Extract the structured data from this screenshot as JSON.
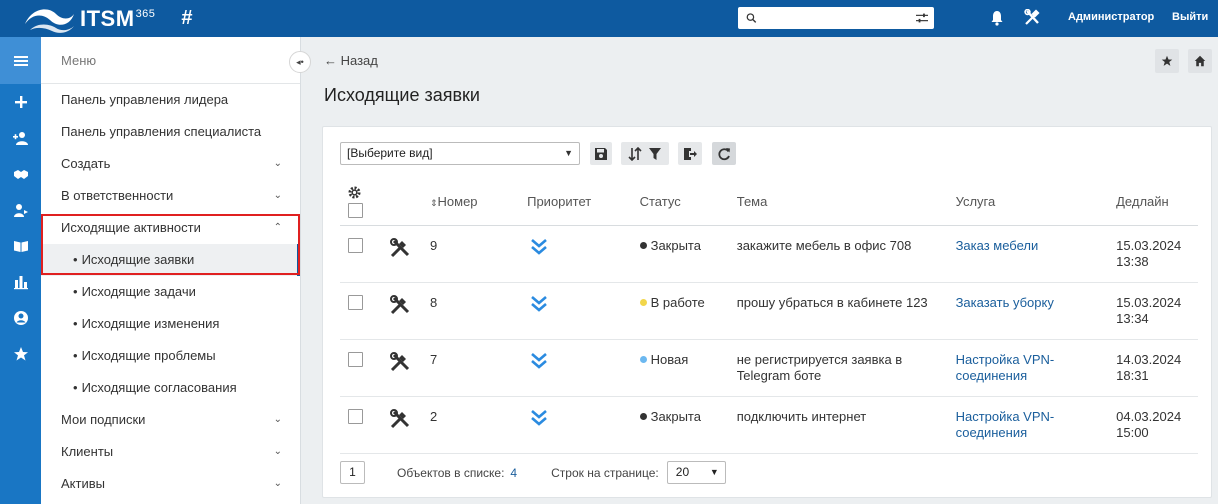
{
  "app": {
    "name": "ITSM",
    "version": "365"
  },
  "topbar": {
    "user": "Администратор",
    "logout": "Выйти",
    "search_value": ""
  },
  "menu": {
    "header": "Меню",
    "items": [
      {
        "label": "Панель управления лидера",
        "chevron": ""
      },
      {
        "label": "Панель управления специалиста",
        "chevron": ""
      },
      {
        "label": "Создать",
        "chevron": "⌄"
      },
      {
        "label": "В ответственности",
        "chevron": "⌄"
      },
      {
        "label": "Исходящие активности",
        "chevron": "⌃"
      },
      {
        "label": "Исходящие заявки",
        "chevron": ""
      },
      {
        "label": "Исходящие задачи",
        "chevron": ""
      },
      {
        "label": "Исходящие изменения",
        "chevron": ""
      },
      {
        "label": "Исходящие проблемы",
        "chevron": ""
      },
      {
        "label": "Исходящие согласования",
        "chevron": ""
      },
      {
        "label": "Мои подписки",
        "chevron": "⌄"
      },
      {
        "label": "Клиенты",
        "chevron": "⌄"
      },
      {
        "label": "Активы",
        "chevron": "⌄"
      }
    ]
  },
  "page": {
    "back": "← Назад",
    "title": "Исходящие заявки"
  },
  "toolbar": {
    "view_select": "[Выберите вид]"
  },
  "table": {
    "columns": [
      "Номер",
      "Приоритет",
      "Статус",
      "Тема",
      "Услуга",
      "Дедлайн"
    ],
    "rows": [
      {
        "number": "9",
        "status": "Закрыта",
        "status_color": "#333333",
        "subject": "закажите мебель в офис 708",
        "service": "Заказ мебели",
        "deadline": "15.03.2024 13:38"
      },
      {
        "number": "8",
        "status": "В работе",
        "status_color": "#f2d64a",
        "subject": "прошу убраться в кабинете 123",
        "service": "Заказать уборку",
        "deadline": "15.03.2024 13:34"
      },
      {
        "number": "7",
        "status": "Новая",
        "status_color": "#6cb8f0",
        "subject": "не регистрируется заявка в Telegram боте",
        "service": "Настройка VPN-соединения",
        "deadline": "14.03.2024 18:31"
      },
      {
        "number": "2",
        "status": "Закрыта",
        "status_color": "#333333",
        "subject": "подключить интернет",
        "service": "Настройка VPN-соединения",
        "deadline": "04.03.2024 15:00"
      }
    ]
  },
  "pager": {
    "page": "1",
    "count_label": "Объектов в списке:",
    "count": "4",
    "rows_label": "Строк на странице:",
    "rows_per_page": "20"
  },
  "colors": {
    "topbar": "#0e5aa0",
    "rail": "#1976c4",
    "link": "#1a5e9c",
    "priority": "#2b8be0",
    "highlight": "#e02020"
  }
}
